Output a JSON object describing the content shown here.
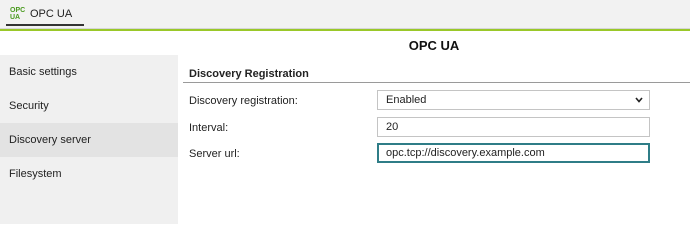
{
  "tabbar": {
    "logo_line1": "OPC",
    "logo_line2": "UA",
    "tab_label": "OPC UA"
  },
  "header": {
    "title": "OPC UA"
  },
  "sidebar": {
    "items": [
      {
        "label": "Basic settings"
      },
      {
        "label": "Security"
      },
      {
        "label": "Discovery server"
      },
      {
        "label": "Filesystem"
      }
    ],
    "active": "Discovery server"
  },
  "main": {
    "section_title": "Discovery Registration",
    "fields": [
      {
        "label": "Discovery registration:",
        "value": "Enabled"
      },
      {
        "label": "Interval:",
        "value": "20"
      },
      {
        "label": "Server url:",
        "value": "opc.tcp://discovery.example.com"
      }
    ]
  },
  "colors": {
    "accent": "#9ac829",
    "logo": "#4a9a1f",
    "focus": "#2f7d87"
  },
  "icons": {
    "logo": "opc-ua-logo",
    "select": "chevron-down-icon"
  }
}
